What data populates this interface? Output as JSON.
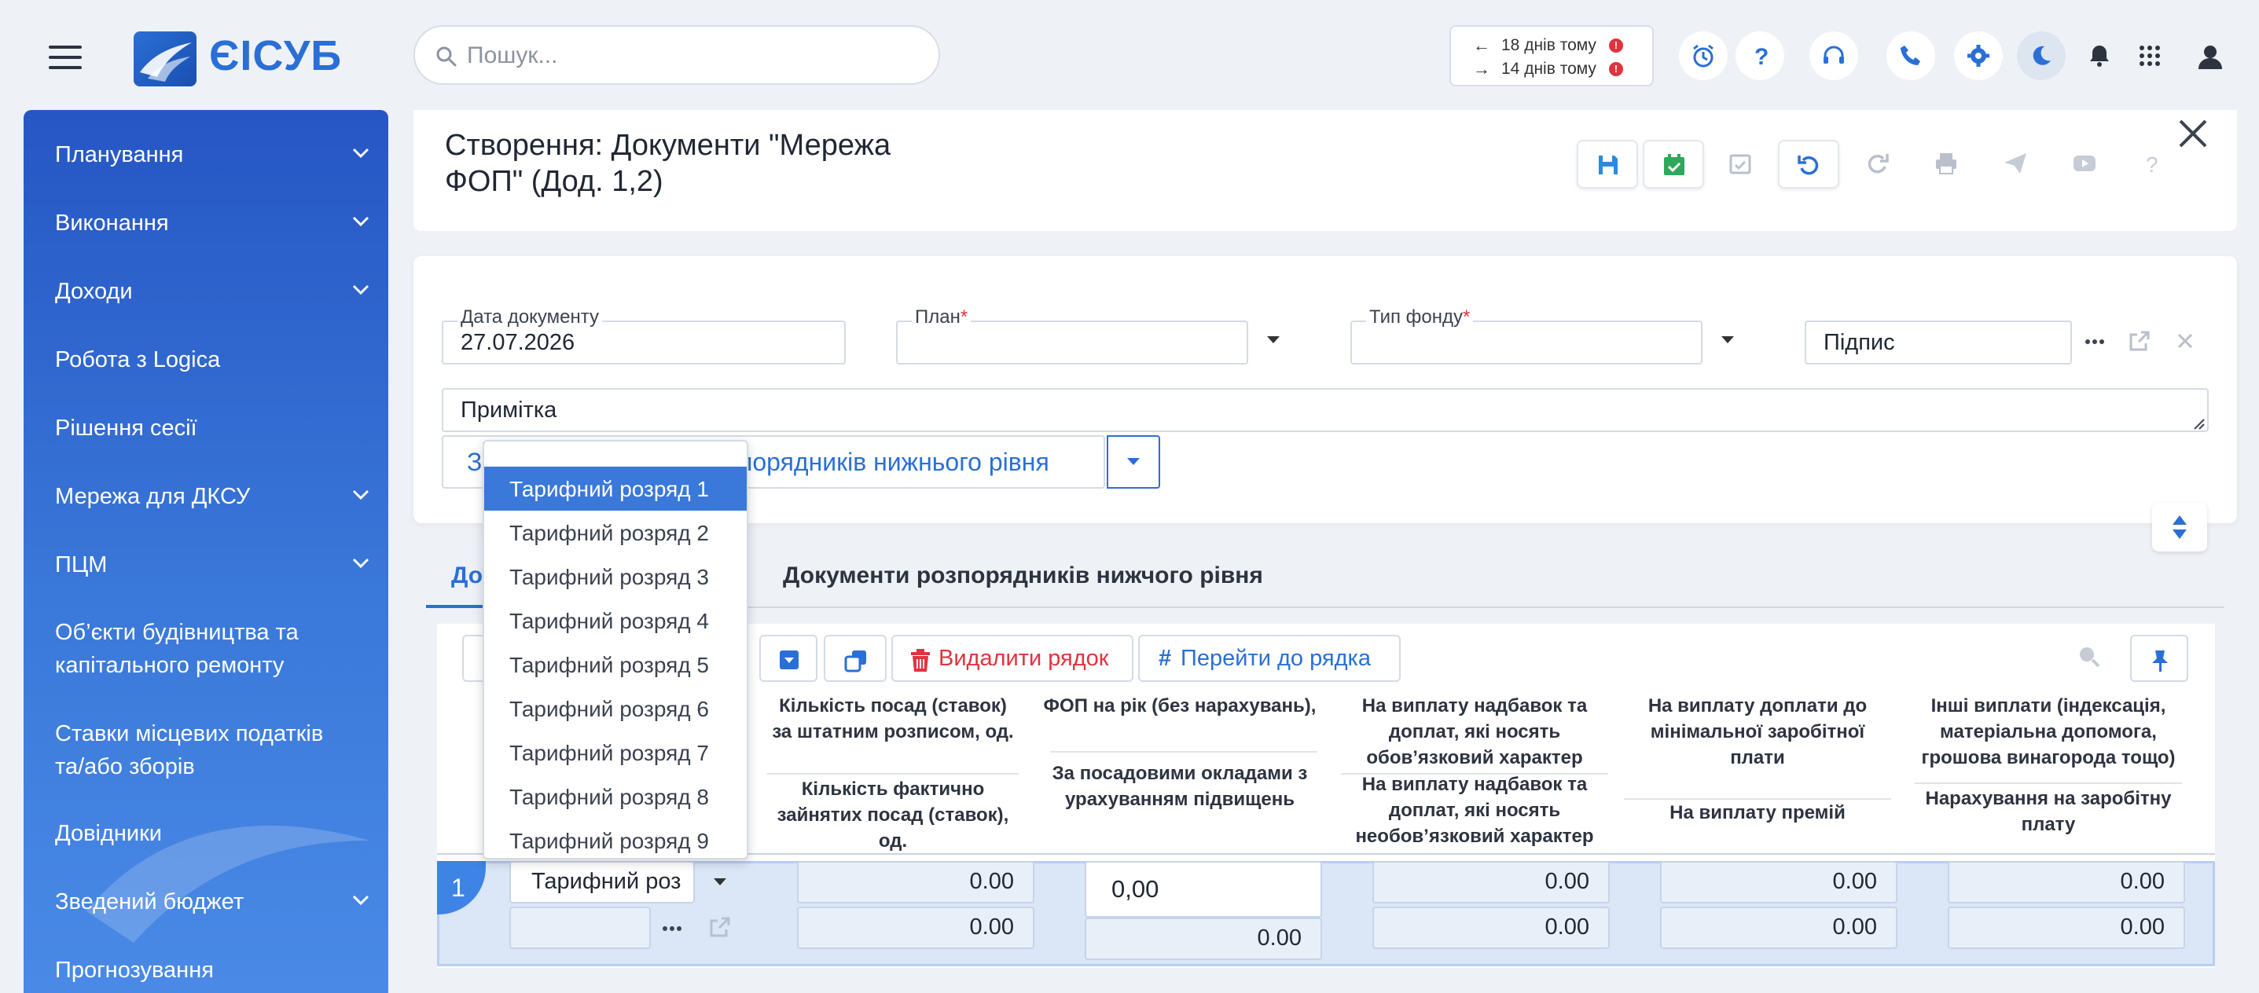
{
  "app": {
    "name": "ЄІСУБ"
  },
  "colors": {
    "accent": "#2a6fd6",
    "sidebar_start": "#2656c4",
    "sidebar_end": "#4a8ae6",
    "danger": "#e0333f",
    "selected_row": "#dbe6f6"
  },
  "search": {
    "placeholder": "Пошук..."
  },
  "history": {
    "back": "18 днів тому",
    "forward": "14 днів тому"
  },
  "topbar_icons": [
    "alarm-clock-icon",
    "help-icon",
    "headset-icon",
    "phone-icon",
    "gear-icon",
    "moon-icon",
    "bell-icon",
    "apps-grid-icon",
    "user-icon"
  ],
  "sidebar": {
    "items": [
      {
        "label": "Планування",
        "expandable": true
      },
      {
        "label": "Виконання",
        "expandable": true
      },
      {
        "label": "Доходи",
        "expandable": true
      },
      {
        "label": "Робота з Logica",
        "expandable": false
      },
      {
        "label": "Рішення сесії",
        "expandable": false
      },
      {
        "label": "Мережа для ДКСУ",
        "expandable": true
      },
      {
        "label": "ПЦМ",
        "expandable": true
      },
      {
        "label": "Об’єкти будівництва та капітального ремонту",
        "expandable": false
      },
      {
        "label": "Ставки місцевих податків та/або зборів",
        "expandable": false
      },
      {
        "label": "Довідники",
        "expandable": false
      },
      {
        "label": "Зведений бюджет",
        "expandable": true
      },
      {
        "label": "Прогнозування",
        "expandable": false
      }
    ]
  },
  "document": {
    "title": "Створення: Документи \"Мережа ФОП\" (Дод. 1,2)",
    "toolbar": [
      "save-icon",
      "calendar-check-icon",
      "calendar-check-disabled-icon",
      "undo-icon",
      "redo-icon",
      "print-icon",
      "send-icon",
      "video-icon",
      "question-icon"
    ]
  },
  "form": {
    "date_label": "Дата документу",
    "date_value": "27.07.2026",
    "plan_label": "План",
    "fund_label": "Тип фонду",
    "required_mark": "*",
    "signature_value": "Підпис",
    "note_value": "Примітка",
    "big_button_prefix": "З",
    "big_button_label": "порядників нижнього рівня"
  },
  "tabs": {
    "first": "До",
    "second": "Документи розпорядників нижчого рівня"
  },
  "grid_toolbar": {
    "delete_row": "Видалити рядок",
    "goto_row": "Перейти до рядка"
  },
  "table": {
    "headers": {
      "h1_top": "Кількість посад (ставок) за штатним розписом, од.",
      "h1_bottom": "Кількість фактично зайнятих посад (ставок), од.",
      "h2_top": "ФОП на рік (без нарахувань),",
      "h2_bottom": "За посадовими окладами з урахуванням підвищень",
      "h3_top": "На виплату надбавок та доплат, які носять обов’язковий характер",
      "h3_bottom": "На виплату надбавок та доплат, які носять необов’язковий характер",
      "h4_top": "На виплату доплати до мінімальної заробітної плати",
      "h4_bottom": "На виплату премій",
      "h5_top": "Інші виплати (індексація, матеріальна допомога, грошова винагорода тощо)",
      "h5_bottom": "Нарахування на заробітну плату"
    },
    "row": {
      "number": "1",
      "rank_value": "Тарифний роз",
      "c1_top": "0.00",
      "c1_bottom": "0.00",
      "c2_top": "0,00",
      "c2_bottom": "0.00",
      "c3_top": "0.00",
      "c3_bottom": "0.00",
      "c4_top": "0.00",
      "c4_bottom": "0.00",
      "c5_top": "0.00",
      "c5_bottom": "0.00"
    }
  },
  "dropdown": {
    "options": [
      "Тарифний розряд 1",
      "Тарифний розряд 2",
      "Тарифний розряд 3",
      "Тарифний розряд 4",
      "Тарифний розряд 5",
      "Тарифний розряд 6",
      "Тарифний розряд 7",
      "Тарифний розряд 8",
      "Тарифний розряд 9"
    ],
    "selected": "Тарифний розряд 1"
  }
}
